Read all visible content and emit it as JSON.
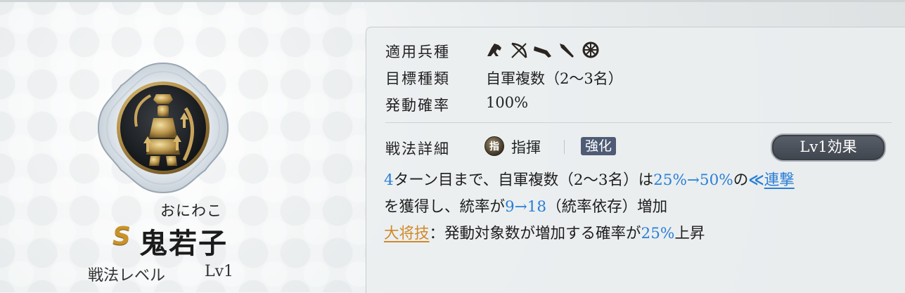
{
  "left": {
    "furigana": "おにわこ",
    "rank": "S",
    "skill_name": "鬼若子",
    "level_label": "戦法レベル",
    "level_value": "Lv1"
  },
  "panel": {
    "troop_label": "適用兵種",
    "troop_icons": [
      "cavalry-icon",
      "bow-icon",
      "gun-icon",
      "spear-icon",
      "wheel-icon"
    ],
    "target_label": "目標種類",
    "target_value": "自軍複数（2〜3名）",
    "rate_label": "発動確率",
    "rate_value": "100%",
    "detail_label": "戦法詳細",
    "command_icon_text": "指",
    "command_label": "指揮",
    "enhance_badge": "強化",
    "lv_button": "Lv1効果",
    "description": {
      "turns": "4",
      "p1": "ターン目まで、自軍複数（2〜3名）は",
      "pct_range": "25%→50%",
      "p2": "の",
      "chain_icon": "≪",
      "chain_link": "連撃",
      "p3": "を獲得し、統率が",
      "stat_range": "9→18",
      "p4": "（統率依存）増加",
      "general_skill": "大将技",
      "p5": "：発動対象数が増加する確率が",
      "chance": "25%",
      "p6": "上昇"
    }
  },
  "colors": {
    "accent_blue": "#2a7fd6",
    "rank_gold": "#c9922a",
    "badge_navy": "#4f5b75"
  }
}
